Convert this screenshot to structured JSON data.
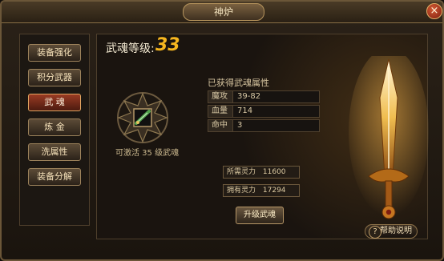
{
  "window": {
    "title": "神炉",
    "close_icon_name": "close-icon"
  },
  "sidebar": {
    "items": [
      {
        "label": "装备强化"
      },
      {
        "label": "积分武器"
      },
      {
        "label": "武 魂"
      },
      {
        "label": "炼 金"
      },
      {
        "label": "洗属性"
      },
      {
        "label": "装备分解"
      }
    ],
    "active_index": 2
  },
  "main": {
    "weapon_soul_level_label": "武魂等级:",
    "weapon_soul_level_value": "33",
    "emblem_caption": "可激活 35 级武魂",
    "attr_title": "已获得武魂属性",
    "attributes": [
      {
        "key": "魔攻",
        "value": "39-82"
      },
      {
        "key": "血量",
        "value": "714"
      },
      {
        "key": "命中",
        "value": "3"
      }
    ],
    "required_spirit": {
      "label": "所需灵力",
      "value": "11600"
    },
    "owned_spirit": {
      "label": "拥有灵力",
      "value": "17294"
    },
    "upgrade_button": "升级武魂",
    "help_button": "帮助说明",
    "help_icon_text": "?"
  },
  "colors": {
    "frame": "#6b5638",
    "accent_gold": "#f6b61f",
    "active_button": "#9a3b23",
    "text_light": "#f4e0b8"
  }
}
